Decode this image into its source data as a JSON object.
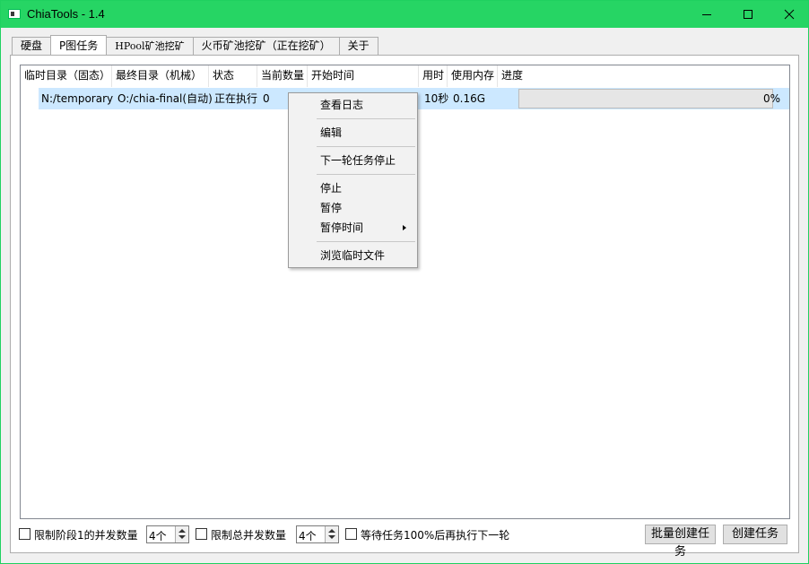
{
  "window": {
    "title": "ChiaTools - 1.4",
    "accent": "#26d564",
    "buttons": [
      "minimize",
      "maximize",
      "close"
    ]
  },
  "tabs": [
    {
      "label": "硬盘",
      "active": false
    },
    {
      "label": "P图任务",
      "active": true
    },
    {
      "label": "HPool矿池挖矿",
      "active": false
    },
    {
      "label": "火币矿池挖矿（正在挖矿）",
      "active": false
    },
    {
      "label": "关于",
      "active": false
    }
  ],
  "table": {
    "columns": [
      "临时目录（固态）",
      "最终目录（机械）",
      "状态",
      "当前数量",
      "开始时间",
      "用时",
      "使用内存",
      "进度"
    ],
    "rows": [
      {
        "temp_dir": "N:/temporary",
        "final_dir": "O:/chia-final(自动)",
        "status": "正在执行",
        "count": "0",
        "start_time": "",
        "elapsed": "10秒",
        "memory": "0.16G",
        "progress": 0,
        "progress_text": "0%"
      }
    ],
    "selected_row_color": "#cce8ff"
  },
  "context_menu": {
    "items": [
      {
        "label": "查看日志"
      },
      {
        "label": "编辑"
      },
      {
        "label": "下一轮任务停止"
      },
      {
        "label": "停止"
      },
      {
        "label": "暂停"
      },
      {
        "label": "暂停时间",
        "submenu": true
      },
      {
        "label": "浏览临时文件"
      }
    ]
  },
  "bottom": {
    "limit_phase1_label": "限制阶段1的并发数量",
    "limit_phase1_value": "4个",
    "limit_total_label": "限制总并发数量",
    "limit_total_value": "4个",
    "wait_label": "等待任务100%后再执行下一轮",
    "batch_create_label": "批量创建任务",
    "create_label": "创建任务"
  }
}
